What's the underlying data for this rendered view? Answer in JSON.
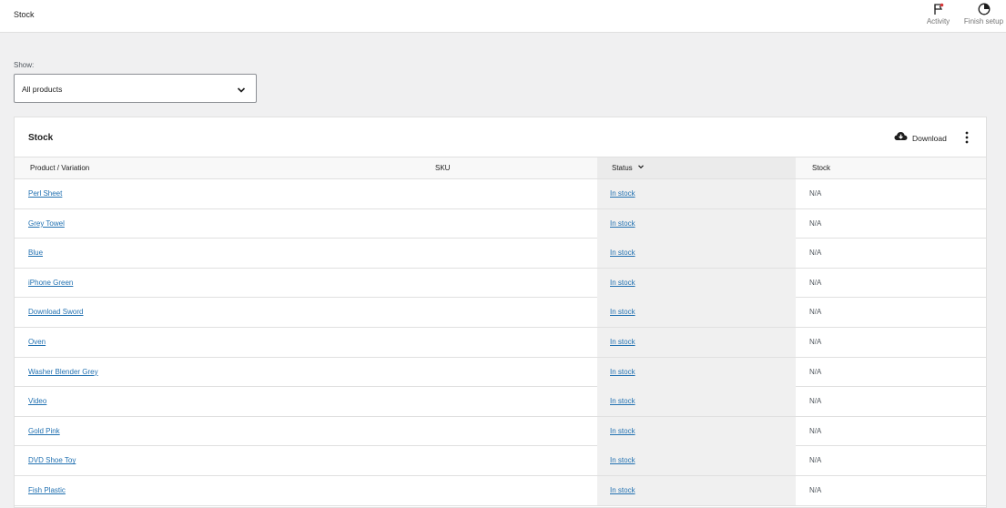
{
  "header": {
    "title": "Stock",
    "activity_label": "Activity",
    "finish_setup_label": "Finish setup"
  },
  "filter": {
    "show_label": "Show:",
    "selected": "All products"
  },
  "card": {
    "title": "Stock",
    "download_label": "Download"
  },
  "table": {
    "columns": {
      "product": "Product / Variation",
      "sku": "SKU",
      "status": "Status",
      "stock": "Stock"
    },
    "rows": [
      {
        "product": "Perl Sheet",
        "sku": "",
        "status": "In stock",
        "stock": "N/A"
      },
      {
        "product": "Grey Towel",
        "sku": "",
        "status": "In stock",
        "stock": "N/A"
      },
      {
        "product": "Blue",
        "sku": "",
        "status": "In stock",
        "stock": "N/A"
      },
      {
        "product": "iPhone Green",
        "sku": "",
        "status": "In stock",
        "stock": "N/A"
      },
      {
        "product": "Download Sword",
        "sku": "",
        "status": "In stock",
        "stock": "N/A"
      },
      {
        "product": "Oven",
        "sku": "",
        "status": "In stock",
        "stock": "N/A"
      },
      {
        "product": "Washer Blender Grey",
        "sku": "",
        "status": "In stock",
        "stock": "N/A"
      },
      {
        "product": "Video",
        "sku": "",
        "status": "In stock",
        "stock": "N/A"
      },
      {
        "product": "Gold Pink",
        "sku": "",
        "status": "In stock",
        "stock": "N/A"
      },
      {
        "product": "DVD Shoe Toy",
        "sku": "",
        "status": "In stock",
        "stock": "N/A"
      },
      {
        "product": "Fish Plastic",
        "sku": "",
        "status": "In stock",
        "stock": "N/A"
      }
    ]
  },
  "colors": {
    "link": "#2271b1",
    "activity_flag_accent": "#d63638",
    "page_bg": "#f0f0f1"
  },
  "icons": {
    "activity": "flag-icon",
    "finish_setup": "progress-circle-icon",
    "download": "cloud-download-icon",
    "more": "vertical-ellipsis-icon",
    "select": "chevron-down-icon",
    "sort": "chevron-down-icon"
  }
}
